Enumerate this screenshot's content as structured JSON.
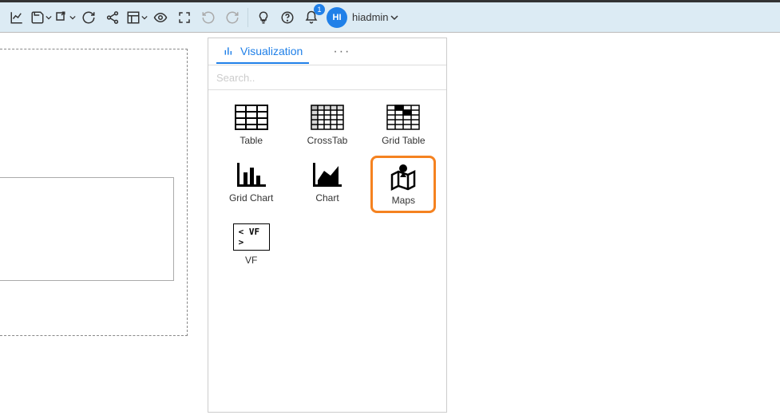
{
  "toolbar": {
    "notif_count": "1",
    "avatar_initials": "HI",
    "username": "hiadmin"
  },
  "panel": {
    "tab_label": "Visualization",
    "tab_more": "···",
    "search_placeholder": "Search..",
    "items": [
      {
        "label": "Table"
      },
      {
        "label": "CrossTab"
      },
      {
        "label": "Grid Table"
      },
      {
        "label": "Grid Chart"
      },
      {
        "label": "Chart"
      },
      {
        "label": "Maps"
      },
      {
        "label": "VF"
      }
    ],
    "vf_icon_text": "< VF >"
  }
}
